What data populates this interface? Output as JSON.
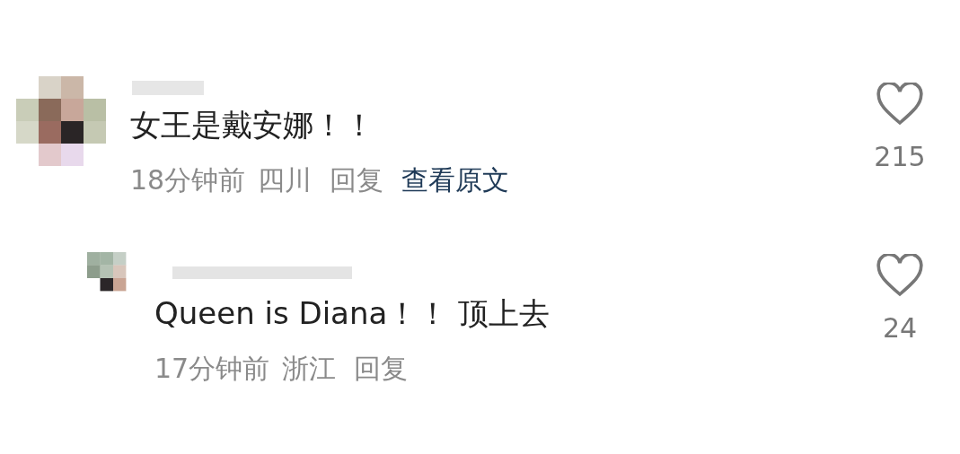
{
  "comments": [
    {
      "text": "女王是戴安娜！！",
      "likes": "215",
      "time": "18分钟前",
      "location": "四川",
      "reply": "回复",
      "view_original": "查看原文",
      "children": [
        {
          "text": "Queen is Diana！！ 顶上去",
          "likes": "24",
          "time": "17分钟前",
          "location": "浙江",
          "reply": "回复"
        }
      ]
    }
  ]
}
